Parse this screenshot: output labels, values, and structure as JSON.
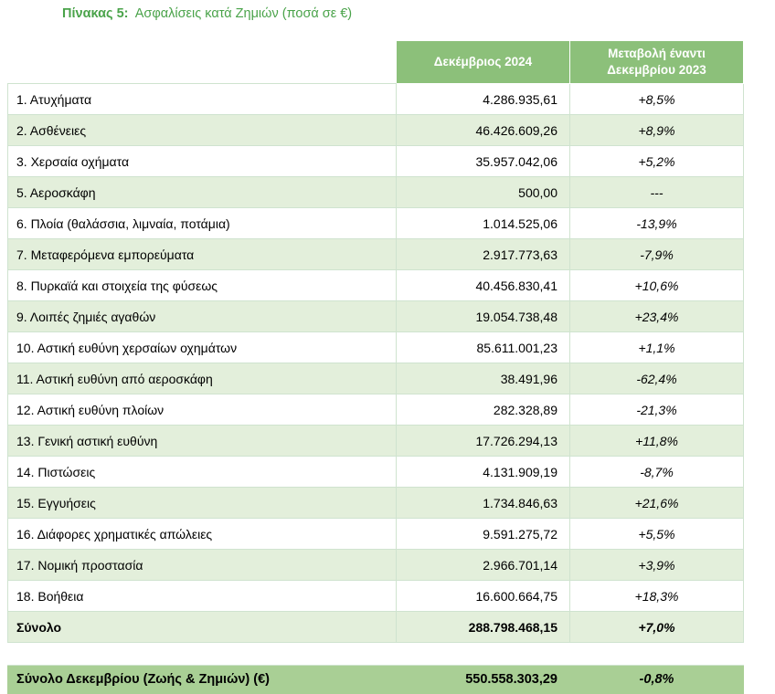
{
  "title": {
    "label": "Πίνακας 5:",
    "text": "Ασφαλίσεις κατά Ζημιών  (ποσά σε €)"
  },
  "header": {
    "col2": "Δεκέμβριος 2024",
    "col3_line1": "Μεταβολή έναντι",
    "col3_line2": "Δεκεμβρίου 2023"
  },
  "rows": [
    {
      "label": "1.   Ατυχήματα",
      "value": "4.286.935,61",
      "change": "+8,5%"
    },
    {
      "label": "2.   Ασθένειες",
      "value": "46.426.609,26",
      "change": "+8,9%"
    },
    {
      "label": "3.   Χερσαία οχήματα",
      "value": "35.957.042,06",
      "change": "+5,2%"
    },
    {
      "label": "5.   Αεροσκάφη",
      "value": "500,00",
      "change": "---"
    },
    {
      "label": "6.   Πλοία (θαλάσσια, λιμναία, ποτάμια)",
      "value": "1.014.525,06",
      "change": "-13,9%"
    },
    {
      "label": "7.   Μεταφερόμενα εμπορεύματα",
      "value": "2.917.773,63",
      "change": "-7,9%"
    },
    {
      "label": "8.   Πυρκαϊά και στοιχεία της φύσεως",
      "value": "40.456.830,41",
      "change": "+10,6%"
    },
    {
      "label": "9.   Λοιπές ζημιές αγαθών",
      "value": "19.054.738,48",
      "change": "+23,4%"
    },
    {
      "label": "10. Αστική ευθύνη χερσαίων οχημάτων",
      "value": "85.611.001,23",
      "change": "+1,1%"
    },
    {
      "label": "11. Αστική ευθύνη από αεροσκάφη",
      "value": "38.491,96",
      "change": "-62,4%"
    },
    {
      "label": "12. Αστική ευθύνη πλοίων",
      "value": "282.328,89",
      "change": "-21,3%"
    },
    {
      "label": "13. Γενική αστική ευθύνη",
      "value": "17.726.294,13",
      "change": "+11,8%"
    },
    {
      "label": "14. Πιστώσεις",
      "value": "4.131.909,19",
      "change": "-8,7%"
    },
    {
      "label": "15. Εγγυήσεις",
      "value": "1.734.846,63",
      "change": "+21,6%"
    },
    {
      "label": "16. Διάφορες χρηματικές απώλειες",
      "value": "9.591.275,72",
      "change": "+5,5%"
    },
    {
      "label": "17. Νομική προστασία",
      "value": "2.966.701,14",
      "change": "+3,9%"
    },
    {
      "label": "18. Βοήθεια",
      "value": "16.600.664,75",
      "change": "+18,3%"
    }
  ],
  "total": {
    "label": "Σύνολο",
    "value": "288.798.468,15",
    "change": "+7,0%"
  },
  "grand_total": {
    "label": "Σύνολο Δεκεμβρίου (Ζωής & Ζημιών) (€)",
    "value": "550.558.303,29",
    "change": "-0,8%"
  },
  "colors": {
    "header_green": "#8cc07a",
    "row_alt": "#e3efdb",
    "grand_green": "#a9cf95",
    "title_green": "#4aa34a"
  }
}
